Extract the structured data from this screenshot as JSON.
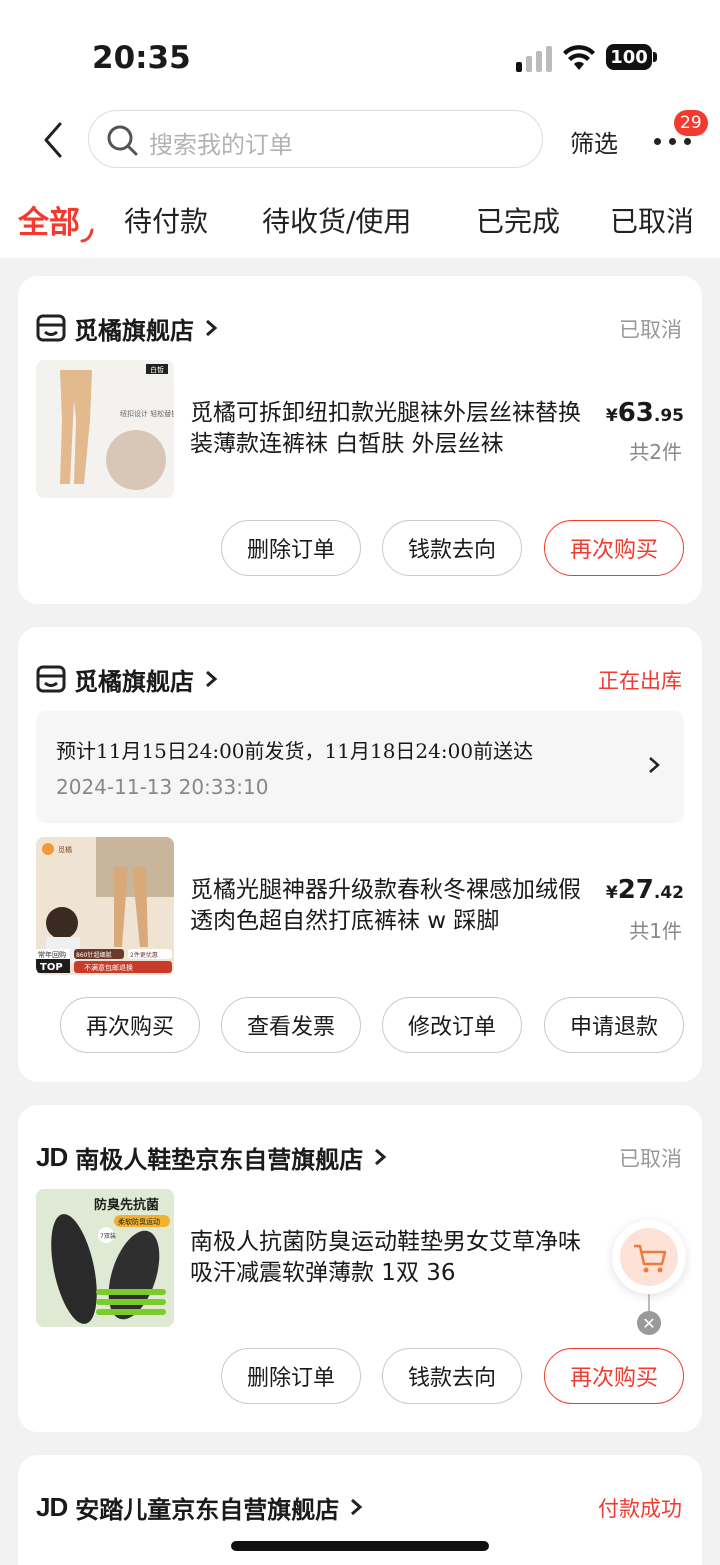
{
  "status_bar": {
    "time": "20:35",
    "battery": "100"
  },
  "header": {
    "search_placeholder": "搜索我的订单",
    "filter_label": "筛选",
    "more_badge": "29"
  },
  "tabs": [
    {
      "label": "全部",
      "active": true
    },
    {
      "label": "待付款"
    },
    {
      "label": "待收货/使用"
    },
    {
      "label": "已完成"
    },
    {
      "label": "已取消"
    }
  ],
  "orders": [
    {
      "store": "觅橘旗舰店",
      "status": "已取消",
      "title": "觅橘可拆卸纽扣款光腿袜外层丝袜替换装薄款连裤袜 白皙肤 外层丝袜",
      "price_symbol": "¥",
      "price_int": "63",
      "price_dec": ".95",
      "count": "共2件",
      "thumb_tag": "白皙",
      "thumb_text": "纽扣设计 轻松替换",
      "buttons": [
        "删除订单",
        "钱款去向",
        "再次购买"
      ]
    },
    {
      "store": "觅橘旗舰店",
      "status": "正在出库",
      "ship_text": "预计11月15日24:00前发货，11月18日24:00前送达",
      "ship_time": "2024-11-13 20:33:10",
      "title": "觅橘光腿神器升级款春秋冬裸感加绒假透肉色超自然打底裤袜 w 踩脚",
      "price_symbol": "¥",
      "price_int": "27",
      "price_dec": ".42",
      "count": "共1件",
      "thumb_brand": "觅橘",
      "thumb_badge_1": "常年回购",
      "thumb_badge_2": "TOP",
      "thumb_badge_3": "860针超细腻",
      "thumb_badge_4": "2件更优惠",
      "thumb_badge_5": "不满意包邮退换",
      "buttons": [
        "再次购买",
        "查看发票",
        "修改订单",
        "申请退款"
      ]
    },
    {
      "store": "南极人鞋垫京东自营旗舰店",
      "store_logo": "JD",
      "status": "已取消",
      "title": "南极人抗菌防臭运动鞋垫男女艾草净味吸汗减震软弹薄款 1双 36",
      "thumb_text_1": "防臭先抗菌",
      "thumb_text_2": "柔软防臭运动",
      "thumb_text_3": "7双装",
      "buttons": [
        "删除订单",
        "钱款去向",
        "再次购买"
      ]
    },
    {
      "store": "安踏儿童京东自营旗舰店",
      "store_logo": "JD",
      "status": "付款成功"
    }
  ],
  "colors": {
    "accent": "#f23a2f",
    "background": "#f2f2f2"
  },
  "icons": [
    "back-icon",
    "search-icon",
    "more-icon",
    "store-icon",
    "chevron-right-icon",
    "cart-icon",
    "close-icon"
  ]
}
